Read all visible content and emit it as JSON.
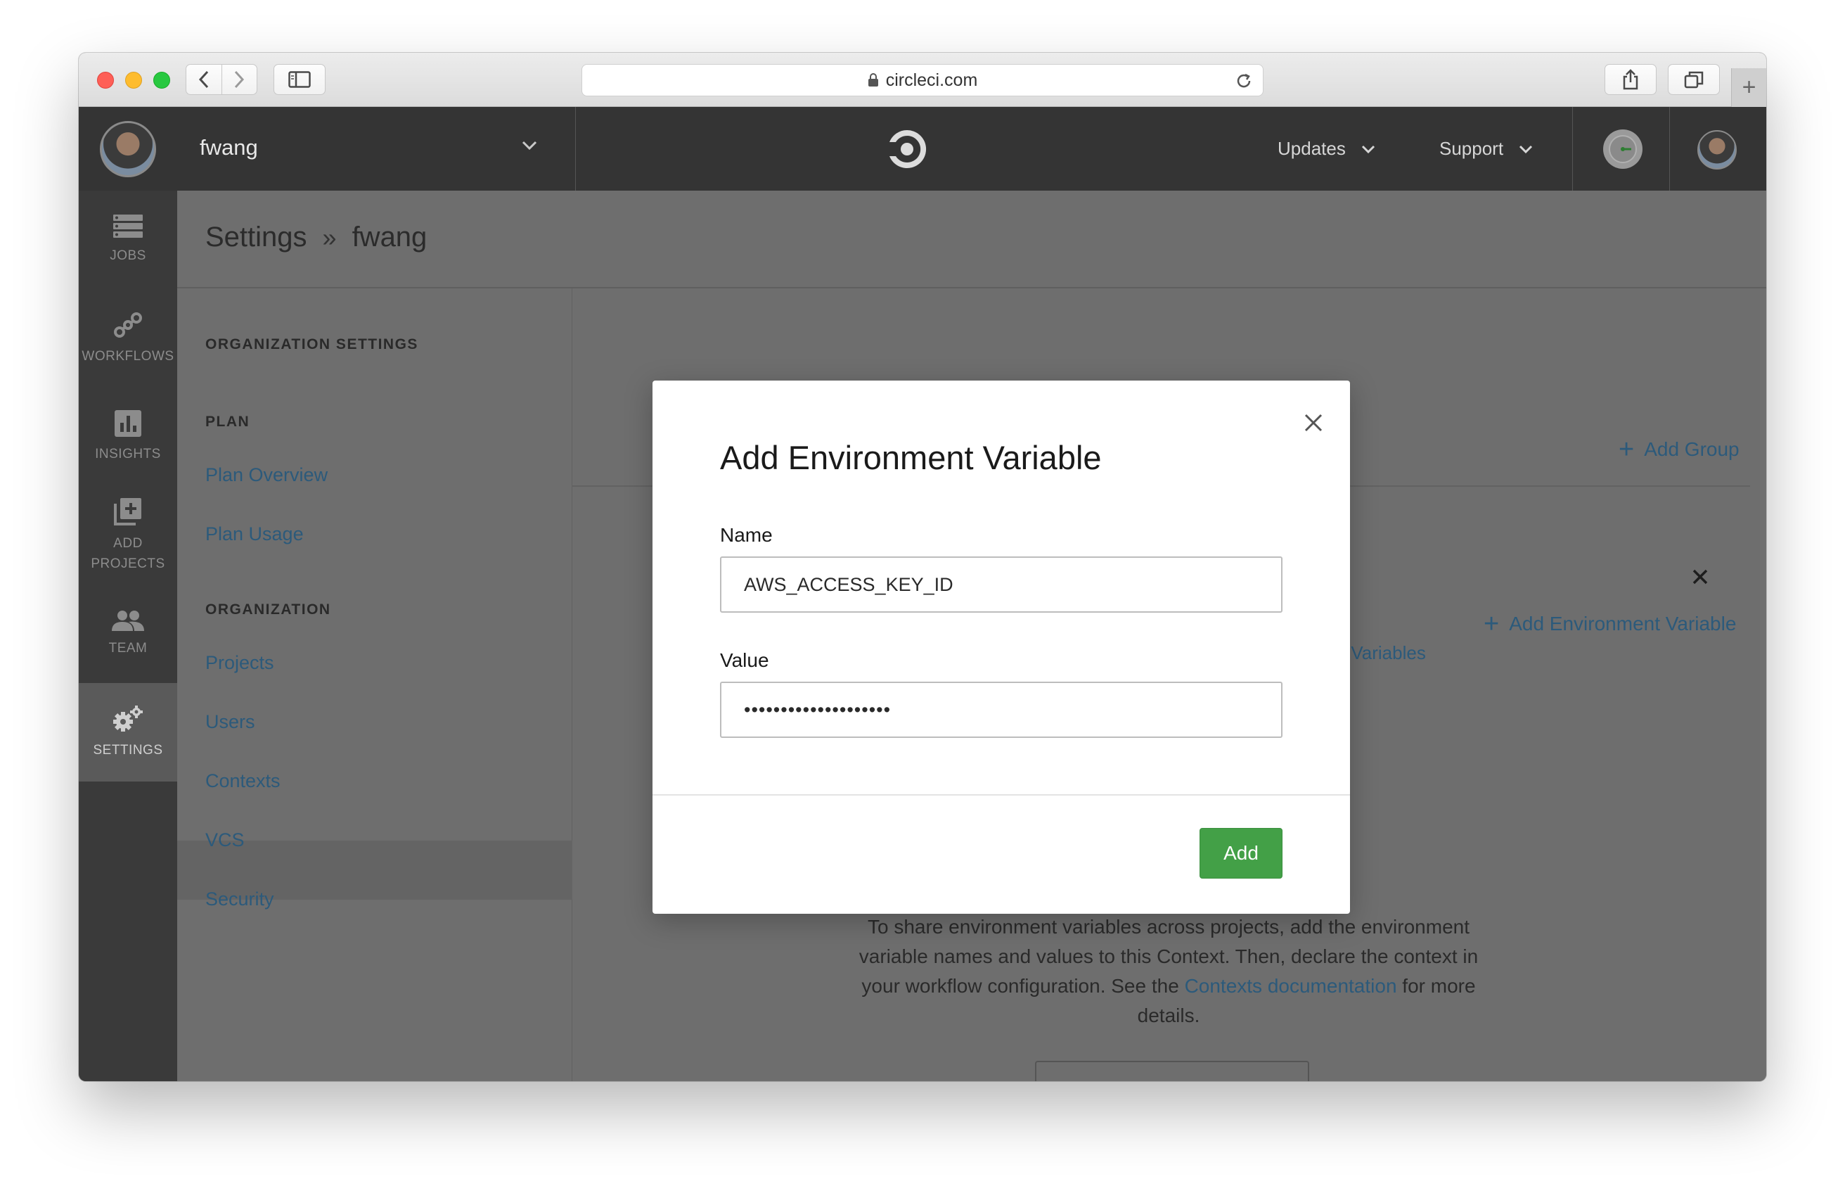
{
  "browser": {
    "url": "circleci.com",
    "new_tab_label": "+"
  },
  "topbar": {
    "org_name": "fwang",
    "nav": [
      {
        "label": "Updates"
      },
      {
        "label": "Support"
      }
    ],
    "colors": {
      "bar": "#343434",
      "status": "#9a9a9a"
    }
  },
  "sidebar": {
    "items": [
      {
        "label": "JOBS",
        "icon": "jobs-icon"
      },
      {
        "label": "WORKFLOWS",
        "icon": "workflows-icon"
      },
      {
        "label": "INSIGHTS",
        "icon": "insights-icon"
      },
      {
        "label": "ADD\nPROJECTS",
        "icon": "add-projects-icon"
      },
      {
        "label": "TEAM",
        "icon": "team-icon"
      },
      {
        "label": "SETTINGS",
        "icon": "gears-icon",
        "active": true
      }
    ]
  },
  "page": {
    "breadcrumb": {
      "root": "Settings",
      "separator": "»",
      "current": "fwang"
    }
  },
  "settings_nav": {
    "section_title": "ORGANIZATION SETTINGS",
    "groups": [
      {
        "heading": "PLAN",
        "links": [
          "Plan Overview",
          "Plan Usage"
        ]
      },
      {
        "heading": "ORGANIZATION",
        "links": [
          "Projects",
          "Users",
          "Contexts",
          "VCS",
          "Security"
        ]
      }
    ],
    "active_link": "Contexts"
  },
  "background_content": {
    "add_group": "Add Group",
    "add_env_var": "Add Environment Variable",
    "env_vars_link_fragment": "vironment Variables",
    "info_text_before": "To share environment variables across projects, add the environment variable names and values to this Context. Then, declare the context in your workflow configuration. See the ",
    "info_link": "Contexts documentation",
    "info_text_after": " for more details."
  },
  "modal": {
    "title": "Add Environment Variable",
    "name_label": "Name",
    "name_value": "AWS_ACCESS_KEY_ID",
    "value_label": "Value",
    "value_masked": "••••••••••••••••••••",
    "submit_label": "Add",
    "accent": "#43a047"
  }
}
